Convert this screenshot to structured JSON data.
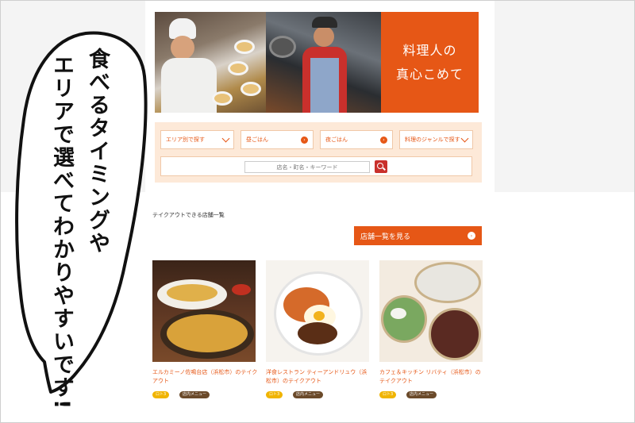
{
  "hero": {
    "tagline_line1": "料理人の",
    "tagline_line2": "真心こめて"
  },
  "search": {
    "filters": [
      {
        "label": "エリア別で探す",
        "icon": "chevron-down-icon"
      },
      {
        "label": "昼ごはん",
        "icon": "arrow-circle-icon"
      },
      {
        "label": "夜ごはん",
        "icon": "arrow-circle-icon"
      },
      {
        "label": "料理のジャンルで探す",
        "icon": "chevron-down-icon"
      }
    ],
    "placeholder": "店名・町名・キーワード"
  },
  "section": {
    "title": "テイクアウトできる店舗一覧",
    "list_button": "店舗一覧を見る"
  },
  "cards": [
    {
      "title": "エルカミーノ佐鳴台店（浜松市）のテイクアウト",
      "tag1": "ロト3",
      "tag2": "店内メニュー"
    },
    {
      "title": "洋食レストラン ティーアンドリュウ（浜松市）のテイクアウト",
      "tag1": "ロト3",
      "tag2": "店内メニュー"
    },
    {
      "title": "カフェ＆キッチン リバティ（浜松市）のテイクアウト",
      "tag1": "ロト3",
      "tag2": "店内メニュー"
    }
  ],
  "annotation": {
    "col1": "食べるタイミングや",
    "col2": "エリアで選べてわかりやすいです!"
  },
  "colors": {
    "accent": "#e65716",
    "search_bg": "#fde9d8",
    "tag_yellow": "#f0b400",
    "tag_brown": "#6b4a2a"
  }
}
